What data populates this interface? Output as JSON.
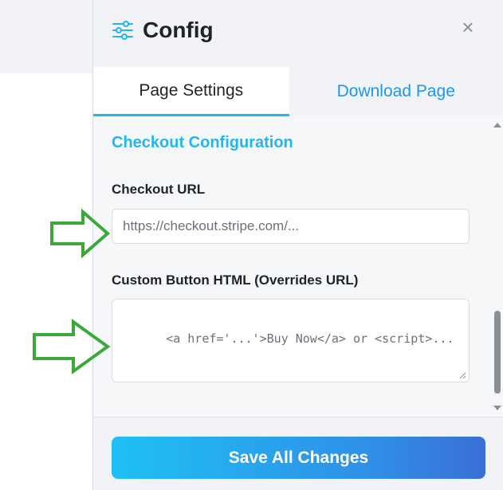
{
  "panel": {
    "title": "Config",
    "close_symbol": "×",
    "icons": {
      "title": "sliders-icon",
      "close": "close-icon"
    }
  },
  "tabs": [
    {
      "label": "Page Settings",
      "active": true
    },
    {
      "label": "Download Page",
      "active": false
    }
  ],
  "section": {
    "title": "Checkout Configuration"
  },
  "fields": {
    "checkout_url": {
      "label": "Checkout URL",
      "placeholder": "https://checkout.stripe.com/..."
    },
    "custom_button": {
      "label": "Custom Button HTML (Overrides URL)",
      "placeholder": "<a href='...'>Buy Now</a> or <script>..."
    }
  },
  "footer": {
    "save_label": "Save All Changes"
  },
  "colors": {
    "accent": "#21b7ee",
    "link": "#2196e8",
    "annotation_arrow": "#3aa93a"
  }
}
